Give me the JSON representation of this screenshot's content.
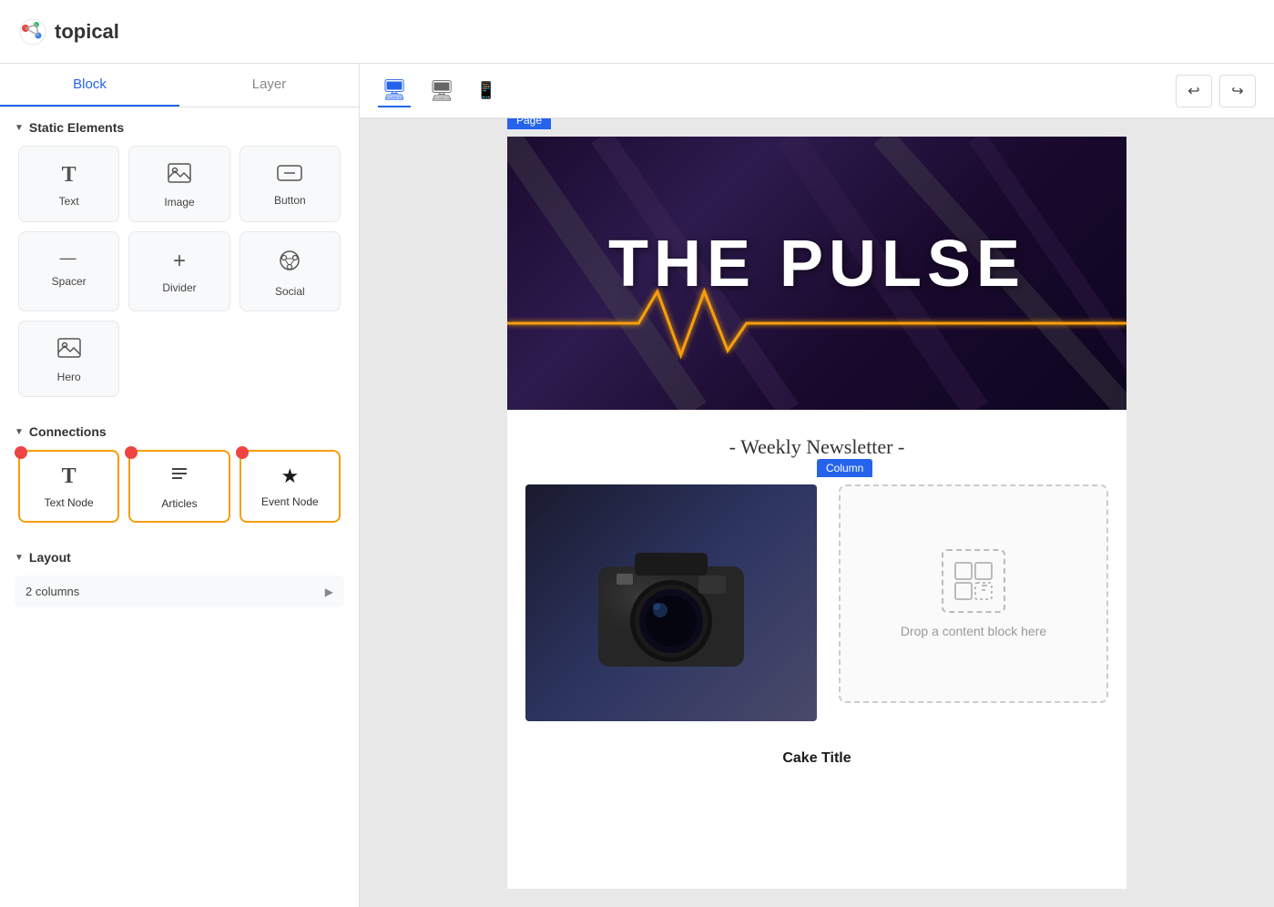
{
  "header": {
    "logo_text": "topical",
    "logo_icon": "🌐"
  },
  "left_panel": {
    "tabs": [
      {
        "id": "block",
        "label": "Block",
        "active": true
      },
      {
        "id": "layer",
        "label": "Layer",
        "active": false
      }
    ],
    "static_elements": {
      "section_label": "Static Elements",
      "items": [
        {
          "id": "text",
          "label": "Text",
          "icon": "T"
        },
        {
          "id": "image",
          "label": "Image",
          "icon": "🖼"
        },
        {
          "id": "button",
          "label": "Button",
          "icon": "⬜"
        },
        {
          "id": "spacer",
          "label": "Spacer",
          "icon": "—"
        },
        {
          "id": "divider",
          "label": "Divider",
          "icon": "+"
        },
        {
          "id": "social",
          "label": "Social",
          "icon": "◎"
        },
        {
          "id": "hero",
          "label": "Hero",
          "icon": "🖼"
        }
      ]
    },
    "connections": {
      "section_label": "Connections",
      "items": [
        {
          "id": "text-node",
          "label": "Text Node",
          "icon": "T",
          "dot_color": "#ef4444"
        },
        {
          "id": "articles",
          "label": "Articles",
          "icon": "≡",
          "dot_color": "#ef4444"
        },
        {
          "id": "event-node",
          "label": "Event Node",
          "icon": "★",
          "dot_color": "#ef4444"
        }
      ]
    },
    "layout": {
      "section_label": "Layout",
      "items": [
        {
          "id": "2-columns",
          "label": "2 columns"
        }
      ]
    }
  },
  "canvas": {
    "device_icons": [
      {
        "id": "desktop",
        "active": true
      },
      {
        "id": "monitor",
        "active": false
      },
      {
        "id": "mobile",
        "active": false
      }
    ],
    "undo_label": "↩",
    "redo_label": "↪",
    "page_label": "Page",
    "column_label": "Column",
    "newsletter": {
      "header_title": "THE PULSE",
      "subtitle": "- Weekly Newsletter -",
      "drop_text": "Drop a content block here",
      "cake_title": "Cake Title"
    }
  }
}
